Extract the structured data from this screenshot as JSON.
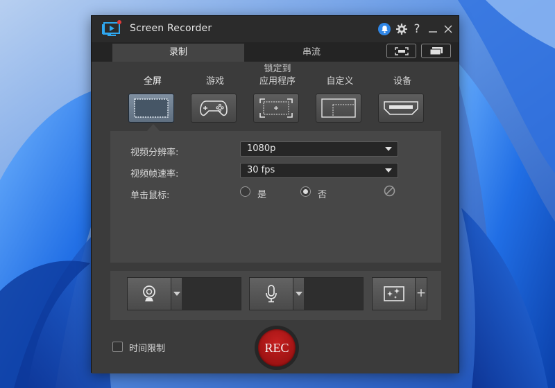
{
  "window": {
    "title": "Screen Recorder",
    "icons": [
      "screen-recorder-logo",
      "bell-icon",
      "gear-icon",
      "help-icon",
      "minimize-icon",
      "close-icon"
    ],
    "help_glyph": "?"
  },
  "tabs": [
    {
      "label": "录制",
      "selected": true
    },
    {
      "label": "串流",
      "selected": false
    }
  ],
  "toolbar_icons": [
    "capture-region-icon",
    "switch-view-icon"
  ],
  "modes": [
    {
      "label": "全屏",
      "icon": "fullscreen-icon",
      "selected": true
    },
    {
      "label": "游戏",
      "icon": "gamepad-icon",
      "selected": false
    },
    {
      "label": "锁定到\n应用程序",
      "icon": "lock-app-icon",
      "selected": false
    },
    {
      "label": "自定义",
      "icon": "custom-region-icon",
      "selected": false
    },
    {
      "label": "设备",
      "icon": "hdmi-device-icon",
      "selected": false
    }
  ],
  "settings": {
    "resolution_label": "视频分辨率:",
    "resolution_value": "1080p",
    "framerate_label": "视频帧速率:",
    "framerate_value": "30 fps",
    "click_label": "单击鼠标:",
    "click_options": [
      {
        "label": "是",
        "selected": false
      },
      {
        "label": "否",
        "selected": true
      }
    ],
    "disabled_icon": "prohibited-icon"
  },
  "devices": {
    "webcam_icon": "webcam-icon",
    "mic_icon": "microphone-icon",
    "effects_icon": "sparkle-effects-icon",
    "add_glyph": "+"
  },
  "footer": {
    "time_limit_label": "时间限制",
    "time_limit_checked": false,
    "rec_label": "REC"
  },
  "colors": {
    "accent_blue": "#2f86e6",
    "rec_red": "#b01818",
    "window_bg": "#2b2b2b",
    "panel_bg": "#474747"
  }
}
